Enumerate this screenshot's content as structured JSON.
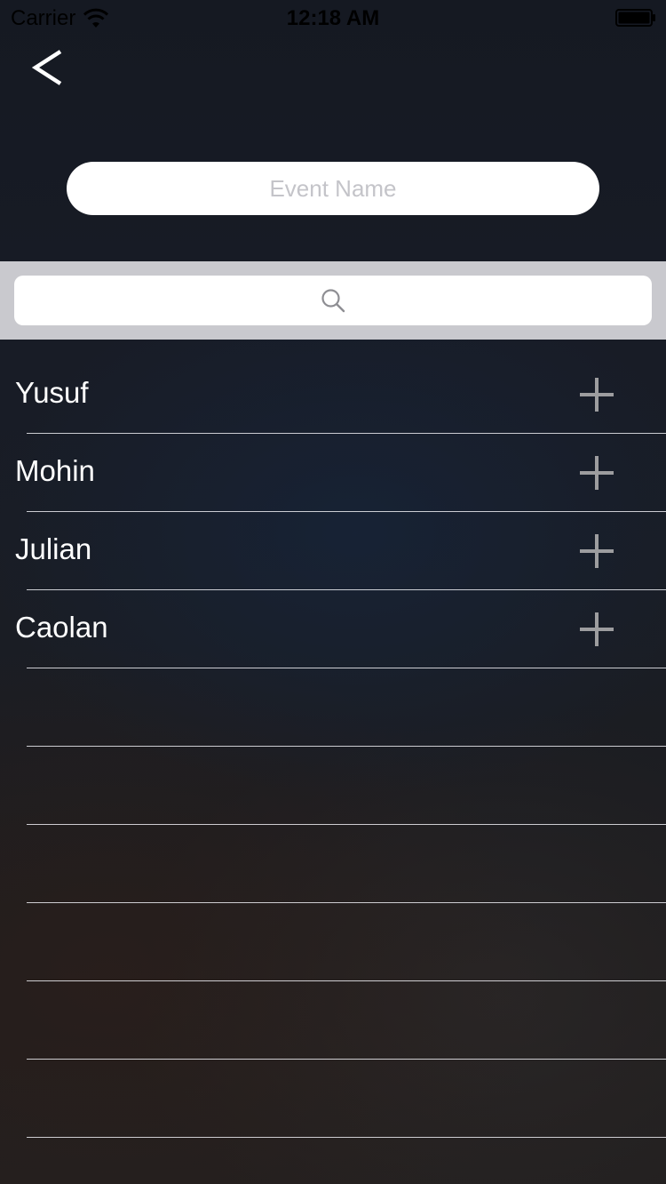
{
  "status_bar": {
    "carrier": "Carrier",
    "time": "12:18 AM",
    "icons": [
      "wifi-icon",
      "battery-icon"
    ]
  },
  "nav": {
    "back_icon": "back-chevron-icon"
  },
  "event_name": {
    "value": "",
    "placeholder": "Event Name"
  },
  "search": {
    "icon": "search-icon",
    "value": ""
  },
  "contacts": [
    {
      "name": "Yusuf",
      "action_icon": "plus-icon"
    },
    {
      "name": "Mohin",
      "action_icon": "plus-icon"
    },
    {
      "name": "Julian",
      "action_icon": "plus-icon"
    },
    {
      "name": "Caolan",
      "action_icon": "plus-icon"
    }
  ],
  "colors": {
    "search_bar_bg": "#c9c9ce",
    "field_bg": "#ffffff",
    "placeholder": "#c4c4c9",
    "plus_icon": "#9d9d9f",
    "text": "#ffffff"
  }
}
